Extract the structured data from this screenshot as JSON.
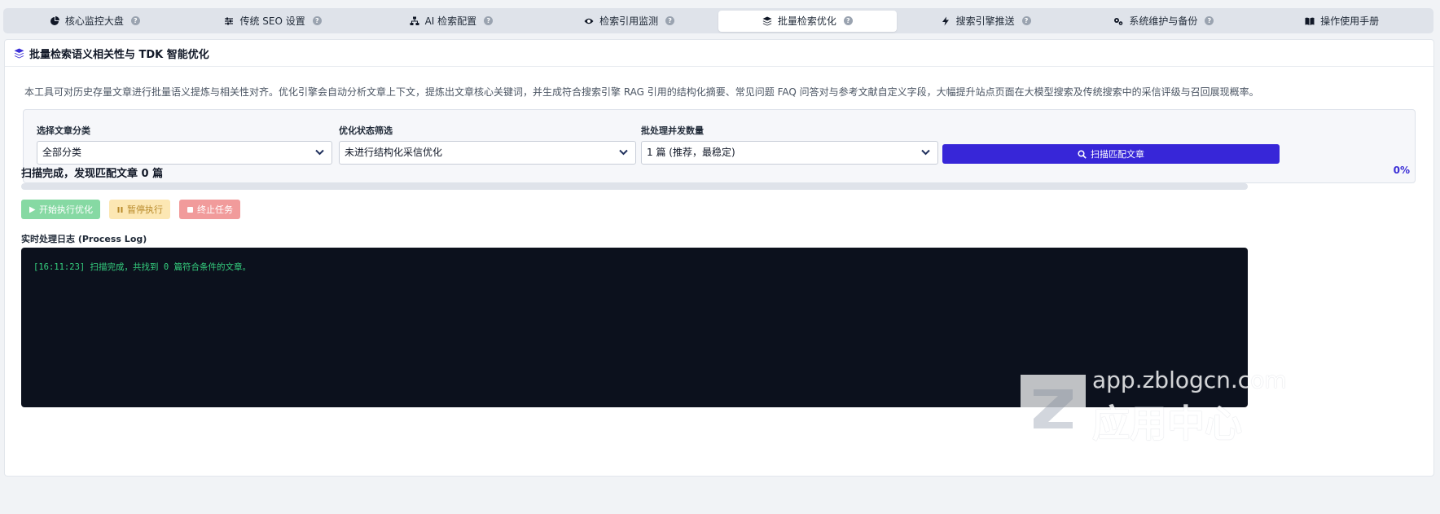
{
  "tabs": [
    {
      "label": "核心监控大盘",
      "icon": "pie-chart-icon",
      "active": false
    },
    {
      "label": "传统 SEO 设置",
      "icon": "sliders-icon",
      "active": false
    },
    {
      "label": "AI 检索配置",
      "icon": "sitemap-icon",
      "active": false
    },
    {
      "label": "检索引用监测",
      "icon": "eye-icon",
      "active": false
    },
    {
      "label": "批量检索优化",
      "icon": "layers-icon",
      "active": true
    },
    {
      "label": "搜索引擎推送",
      "icon": "bolt-icon",
      "active": false
    },
    {
      "label": "系统维护与备份",
      "icon": "gears-icon",
      "active": false
    },
    {
      "label": "操作使用手册",
      "icon": "book-icon",
      "active": false
    }
  ],
  "panel": {
    "title": "批量检索语义相关性与 TDK 智能优化",
    "description": "本工具可对历史存量文章进行批量语义提炼与相关性对齐。优化引擎会自动分析文章上下文，提炼出文章核心关键词，并生成符合搜索引擎 RAG 引用的结构化摘要、常见问题 FAQ 问答对与参考文献自定义字段，大幅提升站点页面在大模型搜索及传统搜索中的采信评级与召回展现概率。"
  },
  "filters": {
    "category_label": "选择文章分类",
    "category_value": "全部分类",
    "status_label": "优化状态筛选",
    "status_value": "未进行结构化采信优化",
    "concurrency_label": "批处理并发数量",
    "concurrency_value": "1 篇 (推荐，最稳定)",
    "scan_button": "扫描匹配文章"
  },
  "progress": {
    "status_text": "扫描完成，发现匹配文章 0 篇",
    "percent_text": "0%",
    "value": 0
  },
  "actions": {
    "start": "开始执行优化",
    "pause": "暂停执行",
    "stop": "终止任务"
  },
  "log": {
    "label": "实时处理日志 (Process Log)",
    "lines": [
      "[16:11:23] 扫描完成，共找到 0 篇符合条件的文章。"
    ]
  },
  "watermark": {
    "url": "app.zblogcn.com",
    "name": "应用中心"
  },
  "colors": {
    "accent": "#3726d8",
    "start": "#86d9a3",
    "pause": "#fce7b3",
    "stop": "#f19b9b",
    "console_bg": "#0c111d",
    "log_text": "#35d07f"
  }
}
